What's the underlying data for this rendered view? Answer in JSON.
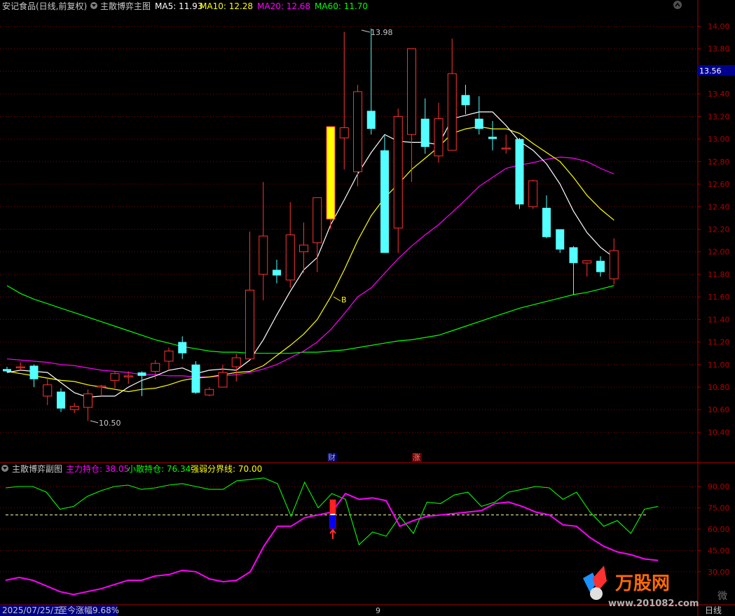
{
  "main": {
    "stock_title": "安记食品(日线,前复权)",
    "indicator_name": "主散博弈主图",
    "ma_legend": [
      {
        "label": "MA5: 11.93",
        "color": "#ffffff"
      },
      {
        "label": "MA10: 12.28",
        "color": "#ffff00"
      },
      {
        "label": "MA20: 12.68",
        "color": "#ff00ff"
      },
      {
        "label": "MA60: 11.70",
        "color": "#00ff00"
      }
    ],
    "y_ticks": [
      "14.00",
      "13.80",
      "13.60",
      "13.40",
      "13.20",
      "13.00",
      "12.80",
      "12.60",
      "12.40",
      "12.20",
      "12.00",
      "11.80",
      "11.60",
      "11.40",
      "11.20",
      "11.00",
      "10.80",
      "10.60",
      "10.40"
    ],
    "current_price": "13.56",
    "high_label": "13.98",
    "low_label": "10.50",
    "buy_marker": "B",
    "event_cai": "财",
    "event_zhang": "涨"
  },
  "sub": {
    "indicator_name": "主散博弈副图",
    "legend": [
      {
        "label": "主力持仓: 38.05",
        "color": "#ff00ff"
      },
      {
        "label": "小散持仓: 76.34",
        "color": "#00ff00"
      },
      {
        "label": "强弱分界线: 70.00",
        "color": "#ffff00"
      }
    ],
    "y_ticks": [
      "90.00",
      "75.00",
      "60.00",
      "45.00",
      "30.00"
    ]
  },
  "status": {
    "date": "2025/07/25/五",
    "change": "至今涨幅9.68%",
    "page_num": "9",
    "period": "日线"
  },
  "watermark": {
    "brand": "万股网",
    "url": "www.201082.com",
    "side_text": "微"
  },
  "colors": {
    "up": "#ff3232",
    "down": "#54ffff",
    "bg": "#000000",
    "grid": "#8b0000"
  },
  "chart_data": {
    "type": "candlestick",
    "candles": [
      {
        "o": 10.96,
        "h": 10.98,
        "l": 10.93,
        "c": 10.94
      },
      {
        "o": 10.98,
        "h": 11.02,
        "l": 10.95,
        "c": 10.98
      },
      {
        "o": 10.99,
        "h": 11.0,
        "l": 10.8,
        "c": 10.87
      },
      {
        "o": 10.72,
        "h": 10.88,
        "l": 10.64,
        "c": 10.82
      },
      {
        "o": 10.76,
        "h": 10.79,
        "l": 10.58,
        "c": 10.61
      },
      {
        "o": 10.6,
        "h": 10.66,
        "l": 10.57,
        "c": 10.63
      },
      {
        "o": 10.62,
        "h": 10.78,
        "l": 10.5,
        "c": 10.74
      },
      {
        "o": 10.8,
        "h": 10.82,
        "l": 10.72,
        "c": 10.81
      },
      {
        "o": 10.86,
        "h": 10.94,
        "l": 10.79,
        "c": 10.92
      },
      {
        "o": 10.89,
        "h": 10.94,
        "l": 10.83,
        "c": 10.9
      },
      {
        "o": 10.93,
        "h": 10.94,
        "l": 10.72,
        "c": 10.9
      },
      {
        "o": 10.94,
        "h": 11.04,
        "l": 10.87,
        "c": 11.01
      },
      {
        "o": 11.03,
        "h": 11.15,
        "l": 10.95,
        "c": 11.12
      },
      {
        "o": 11.2,
        "h": 11.25,
        "l": 11.05,
        "c": 11.1
      },
      {
        "o": 11.0,
        "h": 11.03,
        "l": 10.74,
        "c": 10.75
      },
      {
        "o": 10.73,
        "h": 10.8,
        "l": 10.72,
        "c": 10.78
      },
      {
        "o": 10.8,
        "h": 11.0,
        "l": 10.8,
        "c": 10.93
      },
      {
        "o": 10.98,
        "h": 11.1,
        "l": 10.85,
        "c": 11.06
      },
      {
        "o": 11.05,
        "h": 12.18,
        "l": 11.05,
        "c": 11.66
      },
      {
        "o": 11.8,
        "h": 12.62,
        "l": 11.57,
        "c": 12.14
      },
      {
        "o": 11.84,
        "h": 11.93,
        "l": 11.72,
        "c": 11.79
      },
      {
        "o": 11.75,
        "h": 12.44,
        "l": 11.68,
        "c": 12.15
      },
      {
        "o": 12.0,
        "h": 12.26,
        "l": 11.81,
        "c": 12.06
      },
      {
        "o": 12.08,
        "h": 12.48,
        "l": 11.82,
        "c": 12.48
      },
      {
        "o": 12.29,
        "h": 13.0,
        "l": 12.2,
        "c": 13.11
      },
      {
        "o": 13.01,
        "h": 13.95,
        "l": 12.73,
        "c": 13.1
      },
      {
        "o": 12.71,
        "h": 13.48,
        "l": 12.58,
        "c": 13.42
      },
      {
        "o": 13.25,
        "h": 13.98,
        "l": 13.04,
        "c": 13.09
      },
      {
        "o": 12.9,
        "h": 13.03,
        "l": 11.99,
        "c": 11.99
      },
      {
        "o": 12.21,
        "h": 13.27,
        "l": 11.99,
        "c": 13.2
      },
      {
        "o": 13.04,
        "h": 13.43,
        "l": 12.62,
        "c": 13.8
      },
      {
        "o": 13.18,
        "h": 13.36,
        "l": 12.87,
        "c": 12.93
      },
      {
        "o": 12.85,
        "h": 13.32,
        "l": 12.79,
        "c": 13.18
      },
      {
        "o": 12.9,
        "h": 13.89,
        "l": 12.92,
        "c": 13.58
      },
      {
        "o": 13.39,
        "h": 13.48,
        "l": 13.22,
        "c": 13.3
      },
      {
        "o": 13.18,
        "h": 13.38,
        "l": 13.04,
        "c": 13.09
      },
      {
        "o": 13.02,
        "h": 13.16,
        "l": 12.9,
        "c": 13.0
      },
      {
        "o": 12.92,
        "h": 13.04,
        "l": 12.87,
        "c": 12.92
      },
      {
        "o": 13.0,
        "h": 13.01,
        "l": 12.38,
        "c": 12.42
      },
      {
        "o": 12.4,
        "h": 12.64,
        "l": 12.38,
        "c": 12.63
      },
      {
        "o": 12.39,
        "h": 12.5,
        "l": 12.12,
        "c": 12.13
      },
      {
        "o": 12.2,
        "h": 12.2,
        "l": 11.99,
        "c": 12.02
      },
      {
        "o": 12.04,
        "h": 12.05,
        "l": 11.62,
        "c": 11.9
      },
      {
        "o": 11.9,
        "h": 11.92,
        "l": 11.78,
        "c": 11.92
      },
      {
        "o": 11.92,
        "h": 11.96,
        "l": 11.78,
        "c": 11.82
      },
      {
        "o": 11.76,
        "h": 12.12,
        "l": 11.71,
        "c": 12.01
      }
    ],
    "ma5": [
      10.93,
      10.95,
      10.94,
      10.93,
      10.84,
      10.75,
      10.71,
      10.72,
      10.72,
      10.8,
      10.86,
      10.9,
      10.95,
      10.97,
      10.92,
      10.95,
      10.96,
      10.95,
      11.04,
      11.22,
      11.44,
      11.65,
      11.84,
      11.95,
      12.24,
      12.46,
      12.69,
      12.88,
      13.04,
      12.98,
      12.97,
      12.97,
      12.95,
      13.18,
      13.21,
      13.24,
      13.24,
      13.12,
      12.98,
      12.9,
      12.78,
      12.6,
      12.36,
      12.17,
      12.04,
      11.95
    ],
    "ma10": [
      10.94,
      10.92,
      10.9,
      10.88,
      10.86,
      10.85,
      10.82,
      10.8,
      10.78,
      10.76,
      10.78,
      10.79,
      10.82,
      10.86,
      10.88,
      10.89,
      10.91,
      10.93,
      10.94,
      10.99,
      11.08,
      11.17,
      11.27,
      11.4,
      11.6,
      11.84,
      12.1,
      12.32,
      12.48,
      12.6,
      12.73,
      12.83,
      12.93,
      13.05,
      13.09,
      13.11,
      13.09,
      13.09,
      13.05,
      12.96,
      12.88,
      12.8,
      12.66,
      12.5,
      12.38,
      12.28
    ],
    "ma20": [
      11.05,
      11.04,
      11.03,
      11.02,
      11.0,
      10.99,
      10.97,
      10.95,
      10.94,
      10.93,
      10.91,
      10.91,
      10.9,
      10.9,
      10.89,
      10.89,
      10.9,
      10.91,
      10.93,
      10.96,
      11.0,
      11.06,
      11.12,
      11.2,
      11.31,
      11.45,
      11.6,
      11.68,
      11.81,
      11.94,
      12.05,
      12.15,
      12.24,
      12.35,
      12.46,
      12.58,
      12.66,
      12.74,
      12.77,
      12.79,
      12.82,
      12.84,
      12.83,
      12.8,
      12.74,
      12.69
    ],
    "ma60": [
      11.7,
      11.63,
      11.58,
      11.54,
      11.5,
      11.46,
      11.42,
      11.38,
      11.34,
      11.3,
      11.26,
      11.22,
      11.19,
      11.16,
      11.14,
      11.12,
      11.11,
      11.11,
      11.1,
      11.1,
      11.1,
      11.1,
      11.11,
      11.11,
      11.12,
      11.13,
      11.15,
      11.17,
      11.19,
      11.21,
      11.22,
      11.24,
      11.26,
      11.3,
      11.34,
      11.38,
      11.42,
      11.46,
      11.5,
      11.53,
      11.56,
      11.59,
      11.62,
      11.64,
      11.67,
      11.7
    ],
    "sub_main": [
      24,
      26,
      24,
      20,
      16,
      14,
      16,
      18,
      21,
      24,
      24,
      27,
      28,
      31,
      30,
      25,
      23,
      24,
      30,
      48,
      62,
      62,
      68,
      70,
      72,
      85,
      81,
      82,
      80,
      62,
      66,
      69,
      70,
      71,
      72,
      73,
      78,
      79,
      76,
      72,
      70,
      63,
      62,
      54,
      48,
      44,
      42,
      39,
      38
    ],
    "sub_retail": [
      89,
      90,
      90,
      86,
      74,
      76,
      83,
      87,
      90,
      91,
      88,
      89,
      91,
      92,
      90,
      88,
      88,
      94,
      95,
      96,
      92,
      69,
      93,
      75,
      85,
      81,
      49,
      58,
      55,
      69,
      57,
      79,
      78,
      84,
      86,
      76,
      79,
      86,
      88,
      90,
      89,
      81,
      86,
      72,
      62,
      66,
      57,
      74,
      76
    ],
    "sub_threshold": 70,
    "x_count": 46,
    "ylim": [
      10.3,
      14.1
    ],
    "sub_ylim": [
      20,
      100
    ]
  }
}
